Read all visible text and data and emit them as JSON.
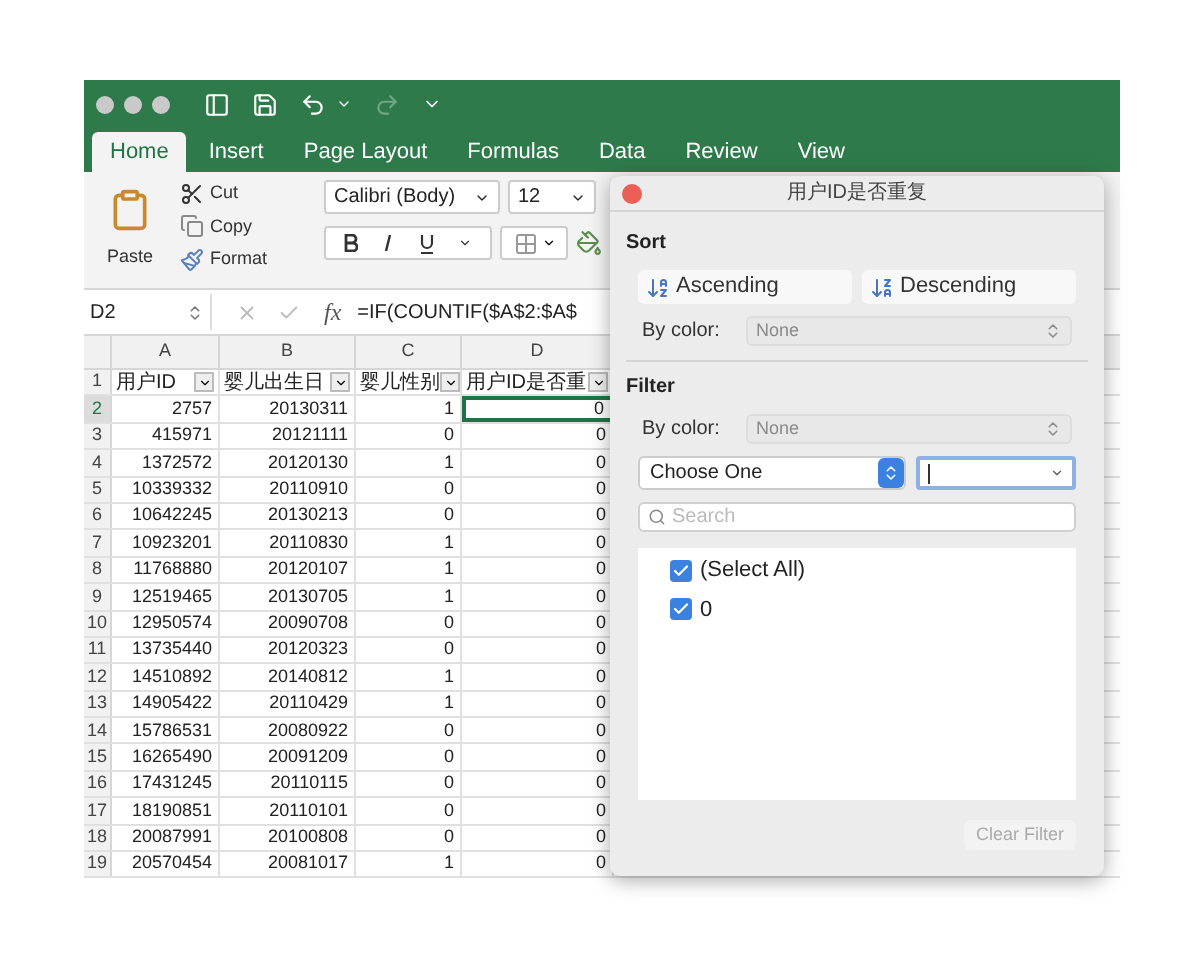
{
  "tabs": [
    {
      "label": "Home",
      "selected": true
    },
    {
      "label": "Insert",
      "selected": false
    },
    {
      "label": "Page Layout",
      "selected": false
    },
    {
      "label": "Formulas",
      "selected": false
    },
    {
      "label": "Data",
      "selected": false
    },
    {
      "label": "Review",
      "selected": false
    },
    {
      "label": "View",
      "selected": false
    }
  ],
  "clipboard": {
    "paste": "Paste",
    "cut": "Cut",
    "copy": "Copy",
    "format": "Format"
  },
  "font": {
    "name": "Calibri (Body)",
    "size": "12"
  },
  "formula_bar": {
    "cell": "D2",
    "function_icon": "fx",
    "formula": "=IF(COUNTIF($A$2:$A$"
  },
  "sheet": {
    "columns": [
      "A",
      "B",
      "C",
      "D"
    ],
    "header_row": {
      "num": "1",
      "cells": [
        "用户ID",
        "婴儿出生日",
        "婴儿性别",
        "用户ID是否重"
      ]
    },
    "rows": [
      {
        "num": "2",
        "cells": [
          "2757",
          "20130311",
          "1",
          "0"
        ],
        "selected": true
      },
      {
        "num": "3",
        "cells": [
          "415971",
          "20121111",
          "0",
          "0"
        ],
        "selected": false
      },
      {
        "num": "4",
        "cells": [
          "1372572",
          "20120130",
          "1",
          "0"
        ],
        "selected": false
      },
      {
        "num": "5",
        "cells": [
          "10339332",
          "20110910",
          "0",
          "0"
        ],
        "selected": false
      },
      {
        "num": "6",
        "cells": [
          "10642245",
          "20130213",
          "0",
          "0"
        ],
        "selected": false
      },
      {
        "num": "7",
        "cells": [
          "10923201",
          "20110830",
          "1",
          "0"
        ],
        "selected": false
      },
      {
        "num": "8",
        "cells": [
          "11768880",
          "20120107",
          "1",
          "0"
        ],
        "selected": false
      },
      {
        "num": "9",
        "cells": [
          "12519465",
          "20130705",
          "1",
          "0"
        ],
        "selected": false
      },
      {
        "num": "10",
        "cells": [
          "12950574",
          "20090708",
          "0",
          "0"
        ],
        "selected": false
      },
      {
        "num": "11",
        "cells": [
          "13735440",
          "20120323",
          "0",
          "0"
        ],
        "selected": false
      },
      {
        "num": "12",
        "cells": [
          "14510892",
          "20140812",
          "1",
          "0"
        ],
        "selected": false
      },
      {
        "num": "13",
        "cells": [
          "14905422",
          "20110429",
          "1",
          "0"
        ],
        "selected": false
      },
      {
        "num": "14",
        "cells": [
          "15786531",
          "20080922",
          "0",
          "0"
        ],
        "selected": false
      },
      {
        "num": "15",
        "cells": [
          "16265490",
          "20091209",
          "0",
          "0"
        ],
        "selected": false
      },
      {
        "num": "16",
        "cells": [
          "17431245",
          "20110115",
          "0",
          "0"
        ],
        "selected": false
      },
      {
        "num": "17",
        "cells": [
          "18190851",
          "20110101",
          "0",
          "0"
        ],
        "selected": false
      },
      {
        "num": "18",
        "cells": [
          "20087991",
          "20100808",
          "0",
          "0"
        ],
        "selected": false
      },
      {
        "num": "19",
        "cells": [
          "20570454",
          "20081017",
          "1",
          "0"
        ],
        "selected": false
      }
    ]
  },
  "dialog": {
    "title": "用户ID是否重复",
    "sort": {
      "heading": "Sort",
      "ascending": "Ascending",
      "descending": "Descending",
      "by_color": {
        "label": "By color:",
        "value": "None",
        "disabled": true
      }
    },
    "filter": {
      "heading": "Filter",
      "by_color": {
        "label": "By color:",
        "value": "None",
        "disabled": true
      },
      "condition": "Choose One",
      "search_placeholder": "Search",
      "values": [
        {
          "label": "(Select All)",
          "checked": true
        },
        {
          "label": "0",
          "checked": true
        }
      ],
      "clear_button": {
        "label": "Clear Filter",
        "disabled": true
      }
    }
  }
}
